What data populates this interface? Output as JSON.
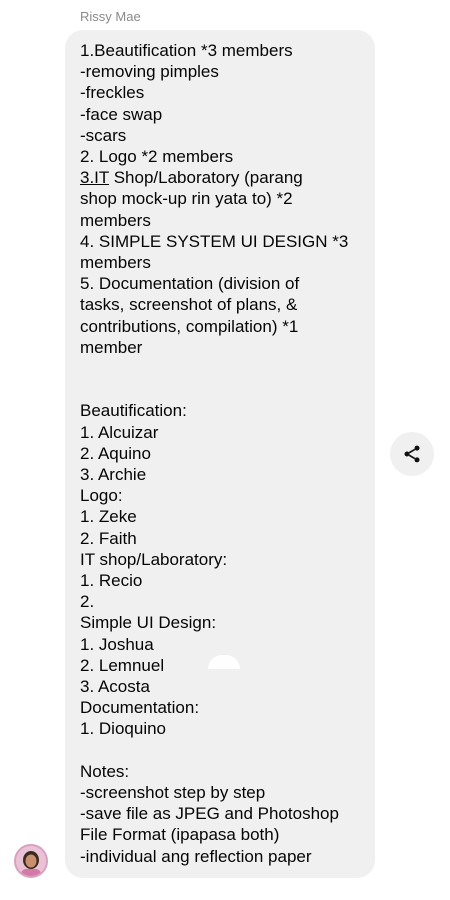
{
  "sender_name": "Rissy Mae",
  "message": {
    "lines": [
      "1.Beautification *3 members",
      "-removing pimples",
      "-freckles",
      "-face swap",
      "-scars",
      "2. Logo *2 members",
      "",
      "shop mock-up rin yata to) *2",
      "members",
      "4. SIMPLE SYSTEM UI DESIGN *3",
      "members",
      "5. Documentation (division of",
      "tasks, screenshot of plans, &",
      "contributions, compilation) *1",
      "member",
      "",
      "",
      "Beautification:",
      "1. Alcuizar",
      "2. Aquino",
      "3. Archie",
      "Logo:",
      "1. Zeke",
      "2. Faith",
      "IT shop/Laboratory:",
      "1. Recio",
      "2.",
      "Simple UI Design:",
      "1. Joshua",
      "2. Lemnuel",
      "3. Acosta",
      "Documentation:",
      "1. Dioquino",
      "",
      "Notes:",
      "-screenshot step by step",
      "-save file as JPEG and Photoshop",
      "File Format (ipapasa both)",
      "-individual ang reflection paper"
    ],
    "it_link_text": "3.IT",
    "it_line_rest": " Shop/Laboratory (parang"
  },
  "icons": {
    "share": "share-icon",
    "avatar": "avatar"
  },
  "colors": {
    "bubble_bg": "#f0f0f0",
    "text": "#050505",
    "sender": "#8a8a8a"
  }
}
